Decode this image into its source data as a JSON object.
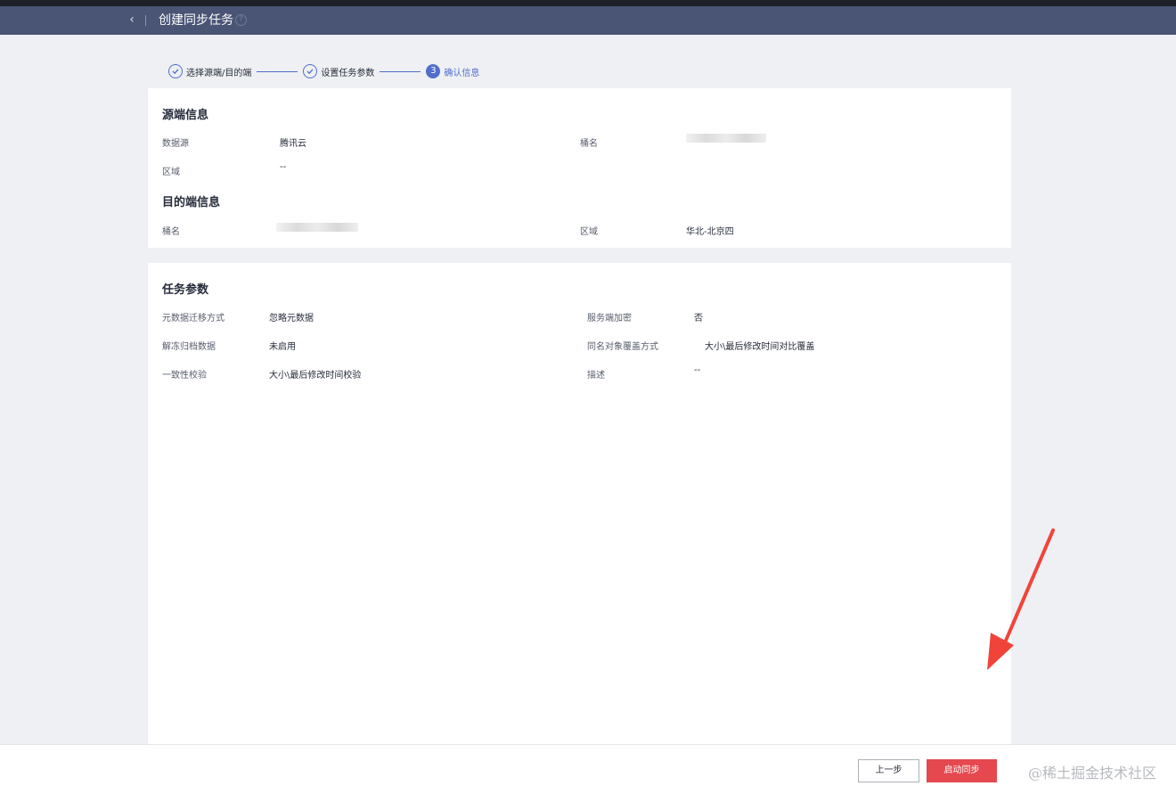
{
  "header": {
    "back_icon": "chevron-left-icon",
    "title": "创建同步任务",
    "help_icon": "question-circle-icon"
  },
  "steps": [
    {
      "label": "选择源端/目的端",
      "state": "done"
    },
    {
      "label": "设置任务参数",
      "state": "done"
    },
    {
      "number": "3",
      "label": "确认信息",
      "state": "active"
    }
  ],
  "source_info": {
    "title": "源端信息",
    "data_source_label": "数据源",
    "data_source_value": "腾讯云",
    "bucket_label": "桶名",
    "region_label": "区域",
    "region_value": "--"
  },
  "dest_info": {
    "title": "目的端信息",
    "bucket_label": "桶名",
    "region_label": "区域",
    "region_value": "华北-北京四"
  },
  "task_params": {
    "title": "任务参数",
    "metadata_label": "元数据迁移方式",
    "metadata_value": "忽略元数据",
    "encryption_label": "服务端加密",
    "encryption_value": "否",
    "thaw_label": "解冻归档数据",
    "thaw_value": "未启用",
    "overwrite_label": "同名对象覆盖方式",
    "overwrite_value": "大小\\最后修改时间对比覆盖",
    "consistency_label": "一致性校验",
    "consistency_value": "大小\\最后修改时间校验",
    "description_label": "描述",
    "description_value": "--"
  },
  "footer": {
    "prev_label": "上一步",
    "start_label": "启动同步",
    "accent_color": "#e5484f"
  },
  "watermark": "@稀土掘金技术社区"
}
